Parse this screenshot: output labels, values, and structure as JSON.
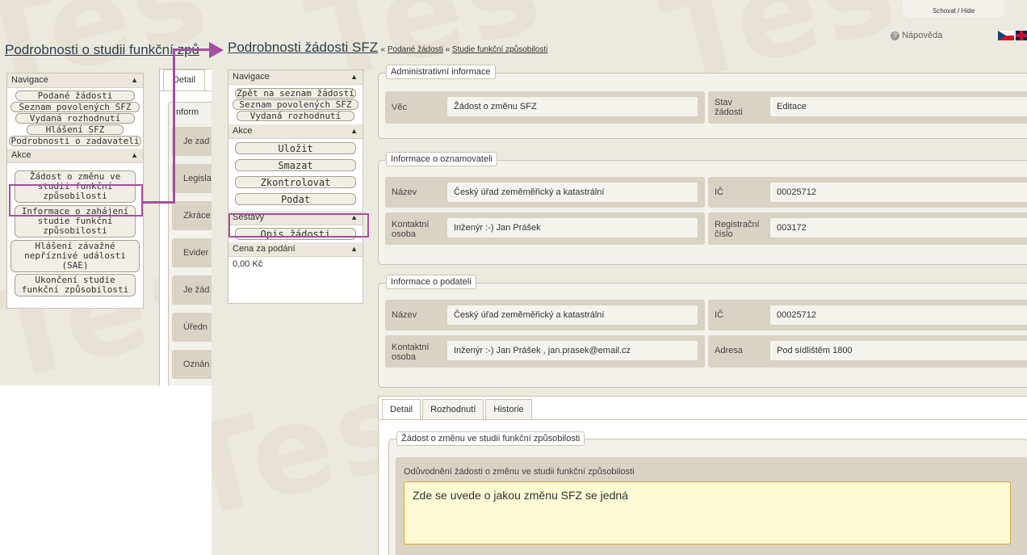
{
  "watermark": "Tes",
  "colors": {
    "highlight": "#a54ea2",
    "accent_text": "#2c3e50",
    "field_background": "#fefbd6"
  },
  "left_screen": {
    "page_title": "Podrobnosti o studii funkční způ",
    "navigation": {
      "title": "Navigace",
      "items": [
        "Podané žádosti",
        "Seznam povolených SFZ",
        "Vydaná rozhodnutí",
        "Hlášení SFZ",
        "Podrobnosti o zadavateli"
      ]
    },
    "actions": {
      "title": "Akce",
      "items": [
        "Žádost o změnu ve studii funkční způsobilosti",
        "Informace o zahájení studie funkční způsobilosti",
        "Hlášení závažné nepříznivé události (SAE)",
        "Ukončení studie funkční způsobilosti"
      ]
    },
    "tab_detail": "Detail",
    "fieldset_label": "Inform",
    "row_labels": [
      "Je zad",
      "Legisla",
      "Zkráce",
      "Evider",
      "Je žád",
      "Úředn",
      "Oznán"
    ]
  },
  "right_screen": {
    "top_tab": "Schovat / Hide",
    "help": "Nápověda",
    "page_title": "Podrobnosti žádosti SFZ",
    "breadcrumb_sep": "«",
    "breadcrumbs": [
      "Podané žádosti",
      "Studie funkční způsobilosti"
    ],
    "navigation": {
      "title": "Navigace",
      "items": [
        "Zpět na seznam žádostí",
        "Seznam povolených SFZ",
        "Vydaná rozhodnutí"
      ]
    },
    "actions": {
      "title": "Akce",
      "items": [
        "Uložit",
        "Smazat",
        "Zkontrolovat",
        "Podat"
      ]
    },
    "reports": {
      "title": "Sestavy",
      "items": [
        "Opis žádosti"
      ]
    },
    "price": {
      "title": "Cena za podání",
      "value": "0,00 Kč"
    },
    "admin": {
      "legend": "Administrativní informace",
      "subject_label": "Věc",
      "subject_value": "Žádost o změnu SFZ",
      "state_label": "Stav žádosti",
      "state_value": "Editace"
    },
    "notifier": {
      "legend": "Informace o oznamovateli",
      "name_label": "Název",
      "name_value": "Český úřad zeměměřický a katastrální",
      "ic_label": "IČ",
      "ic_value": "00025712",
      "contact_label": "Kontaktní osoba",
      "contact_value": "Inženýr :-) Jan Prášek",
      "reg_label": "Registrační číslo",
      "reg_value": "003172"
    },
    "submitter": {
      "legend": "Informace o podateli",
      "name_label": "Název",
      "name_value": "Český úřad zeměměřický a katastrální",
      "ic_label": "IČ",
      "ic_value": "00025712",
      "contact_label": "Kontaktní osoba",
      "contact_value": "Inženýr :-) Jan Prášek , jan.prasek@email.cz",
      "address_label": "Adresa",
      "address_value": "Pod sídlištěm 1800"
    },
    "tabs": [
      "Detail",
      "Rozhodnutí",
      "Historie"
    ],
    "request": {
      "legend": "Žádost o změnu ve studii funkční způsobilosti",
      "reason_label": "Odůvodnění žádosti o změnu ve studii funkční způsobilosti",
      "reason_value": "Zde se uvede o jakou změnu SFZ se jedná"
    }
  }
}
